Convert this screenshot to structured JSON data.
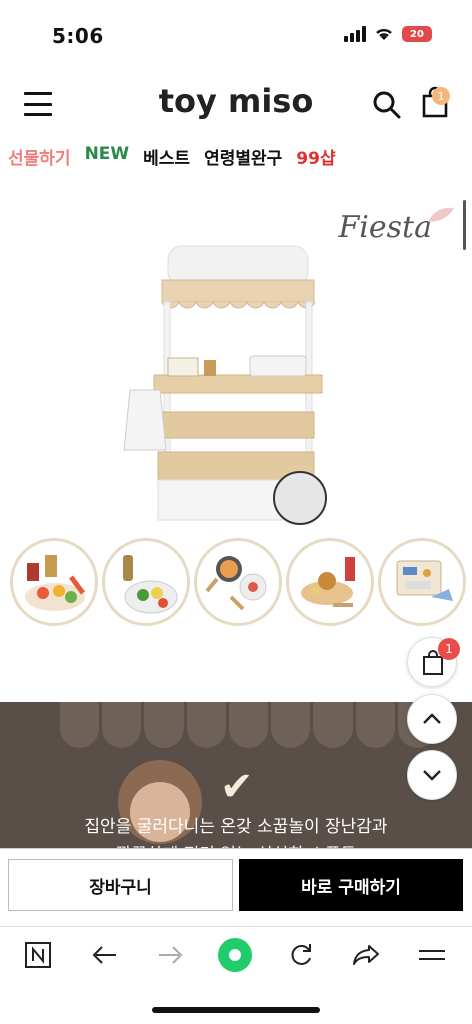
{
  "status": {
    "time": "5:06",
    "battery": "20"
  },
  "header": {
    "logo": "toy miso",
    "cart_count": "1"
  },
  "nav": [
    {
      "label": "선물하기",
      "color": "#f07c7c"
    },
    {
      "label": "NEW",
      "color": "#2a8a4a"
    },
    {
      "label": "베스트",
      "color": "#111111"
    },
    {
      "label": "연령별완구",
      "color": "#111111"
    },
    {
      "label": "99샵",
      "color": "#e03030"
    }
  ],
  "product": {
    "brand_mark": "Fiesta"
  },
  "thumbnails": [
    "thumb-1",
    "thumb-2",
    "thumb-3",
    "thumb-4",
    "thumb-5"
  ],
  "promo": {
    "line1": "집안을 굴러다니는 온갖 소꿉놀이 장난감과",
    "line2": "깔끔하게 정리 없는 심심한 소품들"
  },
  "floating": {
    "cart_count": "1"
  },
  "actions": {
    "cart_label": "장바구니",
    "buy_label": "바로 구매하기"
  },
  "colors": {
    "accent_badge": "#f2b77c",
    "float_badge": "#ea4b4b",
    "buy_bg": "#000000",
    "refresh_green": "#1fce6a"
  }
}
